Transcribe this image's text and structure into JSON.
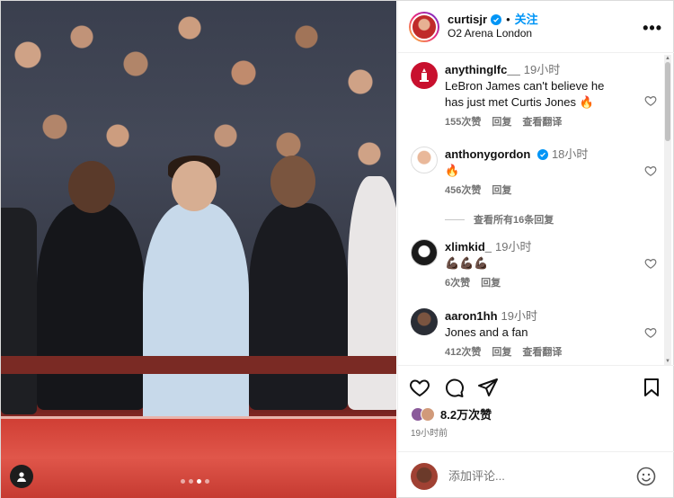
{
  "header": {
    "username": "curtisjr",
    "separator": "•",
    "follow_label": "关注",
    "location": "O2 Arena London",
    "more_label": "•••"
  },
  "photo": {
    "dots_count": 4,
    "active_dot": 2
  },
  "comments": [
    {
      "username": "anythinglfc__",
      "time": "19小时",
      "text": "LeBron James can't believe he has just met Curtis Jones 🔥",
      "likes": "155次赞",
      "reply": "回复",
      "translate": "查看翻译",
      "verified": false
    },
    {
      "username": "anthonygordon",
      "time": "18小时",
      "text": "🔥",
      "likes": "456次赞",
      "reply": "回复",
      "translate": "",
      "verified": true
    },
    {
      "username": "xlimkid_",
      "time": "19小时",
      "text": "💪🏿💪🏿💪🏿",
      "likes": "6次赞",
      "reply": "回复",
      "translate": "",
      "verified": false
    },
    {
      "username": "aaron1hh",
      "time": "19小时",
      "text": "Jones and a fan",
      "likes": "412次赞",
      "reply": "回复",
      "translate": "查看翻译",
      "verified": false
    }
  ],
  "view_replies": "查看所有16条回复",
  "actions": {
    "likes": "8.2万次赞",
    "posted": "19小时前",
    "comment_placeholder": "添加评论..."
  },
  "colors": {
    "accent": "#0095f6",
    "muted": "#737373"
  }
}
